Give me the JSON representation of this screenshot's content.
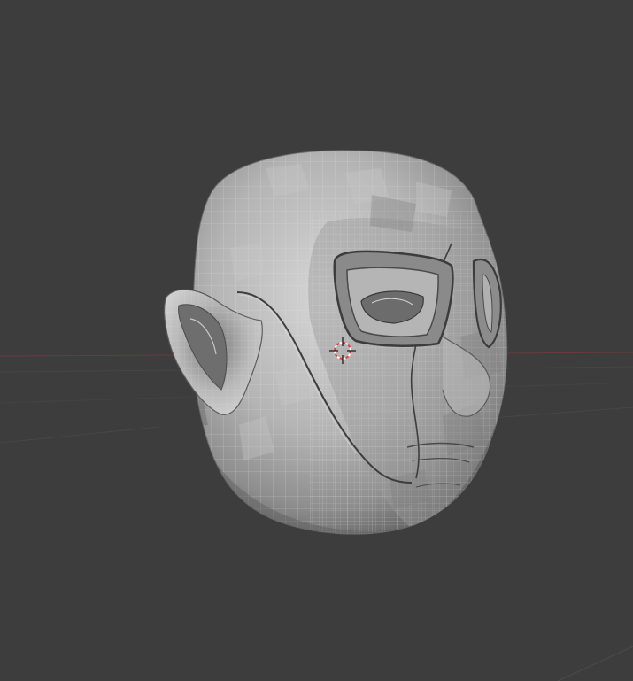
{
  "viewport": {
    "mode": "sculpt",
    "object": "head-mesh",
    "shading": "solid",
    "wireframe_overlay": true,
    "background_color": "#3d3d3d",
    "grid_line_color": "#4a4a4a",
    "x_axis_color": "#7a3a3a",
    "mesh_base_color": "#a8a8a8",
    "mesh_highlight_color": "#d8d8d8",
    "mesh_shadow_color": "#5a5a5a",
    "cursor_ring_color": "#e84040",
    "cursor_icon": "3d-cursor-icon"
  }
}
